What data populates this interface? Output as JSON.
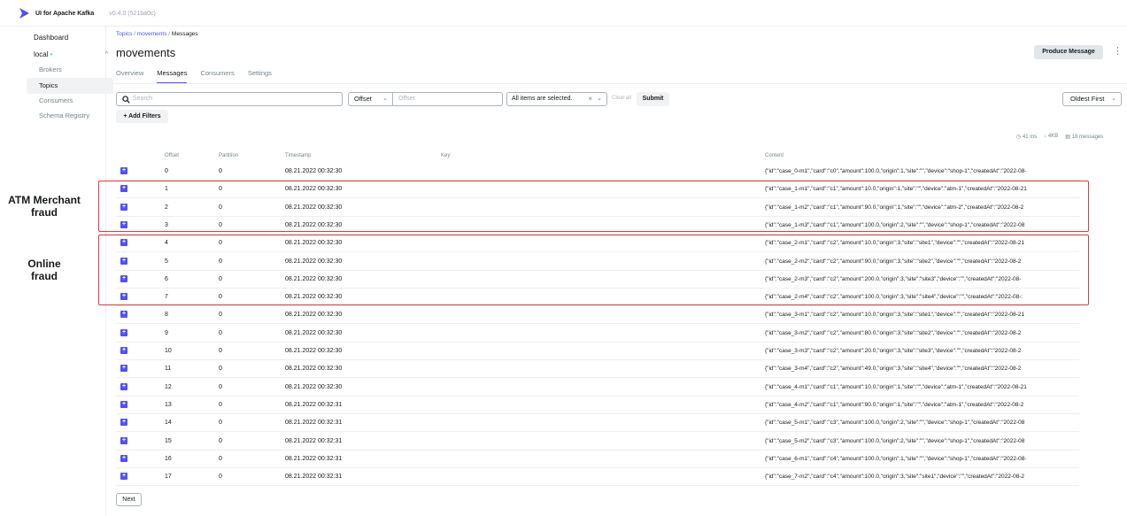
{
  "app": {
    "name": "UI for Apache Kafka",
    "version": "v0.4.0 (521ba0c)"
  },
  "sidebar": {
    "dashboard": "Dashboard",
    "cluster": "local",
    "items": [
      {
        "label": "Brokers",
        "active": false
      },
      {
        "label": "Topics",
        "active": true
      },
      {
        "label": "Consumers",
        "active": false
      },
      {
        "label": "Schema Registry",
        "active": false
      }
    ]
  },
  "breadcrumb": {
    "topics": "Topics",
    "topic": "movements",
    "current": "Messages",
    "sep": "/"
  },
  "page": {
    "title": "movements",
    "produce_label": "Produce Message",
    "kebab": "⋮"
  },
  "tabs": [
    "Overview",
    "Messages",
    "Consumers",
    "Settings"
  ],
  "filters": {
    "search_placeholder": "Search",
    "seek_type": "Offset",
    "offset_placeholder": "Offset",
    "partitions": "All items are selected.",
    "clear_all": "Clear all",
    "submit": "Submit",
    "sort": "Oldest First",
    "add_filters": "+ Add Filters"
  },
  "stats": {
    "elapsed": "41 ms",
    "bytes": "4KB",
    "messages": "18 messages"
  },
  "table": {
    "headers": [
      "Offset",
      "Partition",
      "Timestamp",
      "Key",
      "Content"
    ],
    "rows": [
      {
        "offset": "0",
        "partition": "0",
        "timestamp": "08.21.2022 00:32:30",
        "content": "{\"id\":\"case_0-m1\",\"card\":\"c0\",\"amount\":100.0,\"origin\":1,\"site\":\"\",\"device\":\"shop-1\",\"createdAt\":\"2022-08-"
      },
      {
        "offset": "1",
        "partition": "0",
        "timestamp": "08.21.2022 00:32:30",
        "content": "{\"id\":\"case_1-m1\",\"card\":\"c1\",\"amount\":10.0,\"origin\":1,\"site\":\"\",\"device\":\"atm-1\",\"createdAt\":\"2022-08-21"
      },
      {
        "offset": "2",
        "partition": "0",
        "timestamp": "08.21.2022 00:32:30",
        "content": "{\"id\":\"case_1-m2\",\"card\":\"c1\",\"amount\":90.0,\"origin\":1,\"site\":\"\",\"device\":\"atm-2\",\"createdAt\":\"2022-08-2"
      },
      {
        "offset": "3",
        "partition": "0",
        "timestamp": "08.21.2022 00:32:30",
        "content": "{\"id\":\"case_1-m3\",\"card\":\"c1\",\"amount\":100.0,\"origin\":2,\"site\":\"\",\"device\":\"shop-1\",\"createdAt\":\"2022-08"
      },
      {
        "offset": "4",
        "partition": "0",
        "timestamp": "08.21.2022 00:32:30",
        "content": "{\"id\":\"case_2-m1\",\"card\":\"c2\",\"amount\":10.0,\"origin\":3,\"site\":\"site1\",\"device\":\"\",\"createdAt\":\"2022-08-21"
      },
      {
        "offset": "5",
        "partition": "0",
        "timestamp": "08.21.2022 00:32:30",
        "content": "{\"id\":\"case_2-m2\",\"card\":\"c2\",\"amount\":90.0,\"origin\":3,\"site\":\"site2\",\"device\":\"\",\"createdAt\":\"2022-08-2"
      },
      {
        "offset": "6",
        "partition": "0",
        "timestamp": "08.21.2022 00:32:30",
        "content": "{\"id\":\"case_2-m3\",\"card\":\"c2\",\"amount\":200.0,\"origin\":3,\"site\":\"site3\",\"device\":\"\",\"createdAt\":\"2022-08-"
      },
      {
        "offset": "7",
        "partition": "0",
        "timestamp": "08.21.2022 00:32:30",
        "content": "{\"id\":\"case_2-m4\",\"card\":\"c2\",\"amount\":100.0,\"origin\":3,\"site\":\"site4\",\"device\":\"\",\"createdAt\":\"2022-08-:"
      },
      {
        "offset": "8",
        "partition": "0",
        "timestamp": "08.21.2022 00:32:30",
        "content": "{\"id\":\"case_3-m1\",\"card\":\"c2\",\"amount\":10.0,\"origin\":3,\"site\":\"site1\",\"device\":\"\",\"createdAt\":\"2022-08-21"
      },
      {
        "offset": "9",
        "partition": "0",
        "timestamp": "08.21.2022 00:32:30",
        "content": "{\"id\":\"case_3-m2\",\"card\":\"c2\",\"amount\":80.0,\"origin\":3,\"site\":\"site2\",\"device\":\"\",\"createdAt\":\"2022-08-2"
      },
      {
        "offset": "10",
        "partition": "0",
        "timestamp": "08.21.2022 00:32:30",
        "content": "{\"id\":\"case_3-m3\",\"card\":\"c2\",\"amount\":20.0,\"origin\":3,\"site\":\"site3\",\"device\":\"\",\"createdAt\":\"2022-08-2"
      },
      {
        "offset": "11",
        "partition": "0",
        "timestamp": "08.21.2022 00:32:30",
        "content": "{\"id\":\"case_3-m4\",\"card\":\"c2\",\"amount\":49.0,\"origin\":3,\"site\":\"site4\",\"device\":\"\",\"createdAt\":\"2022-08-2"
      },
      {
        "offset": "12",
        "partition": "0",
        "timestamp": "08.21.2022 00:32:30",
        "content": "{\"id\":\"case_4-m1\",\"card\":\"c1\",\"amount\":10.0,\"origin\":1,\"site\":\"\",\"device\":\"atm-1\",\"createdAt\":\"2022-08-21"
      },
      {
        "offset": "13",
        "partition": "0",
        "timestamp": "08.21.2022 00:32:31",
        "content": "{\"id\":\"case_4-m2\",\"card\":\"c1\",\"amount\":90.0,\"origin\":1,\"site\":\"\",\"device\":\"atm-1\",\"createdAt\":\"2022-08-2"
      },
      {
        "offset": "14",
        "partition": "0",
        "timestamp": "08.21.2022 00:32:31",
        "content": "{\"id\":\"case_5-m1\",\"card\":\"c3\",\"amount\":100.0,\"origin\":2,\"site\":\"\",\"device\":\"shop-1\",\"createdAt\":\"2022-08"
      },
      {
        "offset": "15",
        "partition": "0",
        "timestamp": "08.21.2022 00:32:31",
        "content": "{\"id\":\"case_5-m2\",\"card\":\"c3\",\"amount\":100.0,\"origin\":2,\"site\":\"\",\"device\":\"shop-1\",\"createdAt\":\"2022-08"
      },
      {
        "offset": "16",
        "partition": "0",
        "timestamp": "08.21.2022 00:32:31",
        "content": "{\"id\":\"case_6-m1\",\"card\":\"c4\",\"amount\":100.0,\"origin\":1,\"site\":\"\",\"device\":\"shop-1\",\"createdAt\":\"2022-08-"
      },
      {
        "offset": "17",
        "partition": "0",
        "timestamp": "08.21.2022 00:32:31",
        "content": "{\"id\":\"case_7-m2\",\"card\":\"c4\",\"amount\":100.0,\"origin\":3,\"site\":\"site1\",\"device\":\"\",\"createdAt\":\"2022-08-2"
      }
    ]
  },
  "pagination": {
    "next": "Next"
  },
  "annotations": [
    {
      "line1": "ATM Merchant",
      "line2": "fraud"
    },
    {
      "line1": "Online",
      "line2": "fraud"
    }
  ],
  "colors": {
    "accent": "#4f4ffe",
    "annotation": "#e03a3a",
    "online": "#5cd685"
  }
}
